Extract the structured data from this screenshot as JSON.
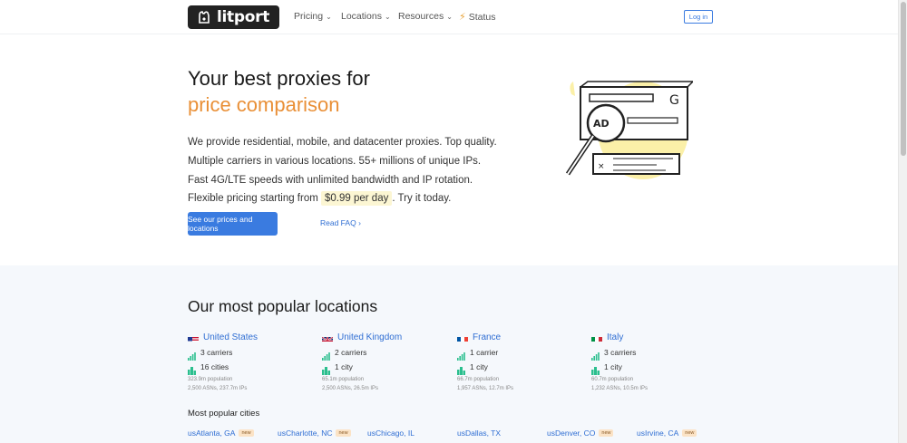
{
  "nav": {
    "logo_text": "litport",
    "items": [
      {
        "label": "Pricing"
      },
      {
        "label": "Locations"
      },
      {
        "label": "Resources"
      }
    ],
    "status_label": "Status",
    "login_label": "Log in"
  },
  "hero": {
    "title_line1": "Your best proxies for",
    "title_line2": "price comparison",
    "lines": [
      "We provide residential, mobile, and datacenter proxies. Top quality.",
      "Multiple carriers in various locations. 55+ millions of unique IPs.",
      "Fast 4G/LTE speeds with unlimited bandwidth and IP rotation."
    ],
    "pricing_prefix": "Flexible pricing starting from",
    "price": "$0.99 per day",
    "pricing_suffix": ". Try it today.",
    "cta_label": "See our prices and locations",
    "faq_label": "Read FAQ",
    "faq_arrow": "›"
  },
  "locations": {
    "heading": "Our most popular locations",
    "countries": [
      {
        "name": "United States",
        "carriers": "3 carriers",
        "cities": "16 cities",
        "population": "323.9m population",
        "asns": "2,500 ASNs, 237.7m IPs"
      },
      {
        "name": "United Kingdom",
        "carriers": "2 carriers",
        "cities": "1 city",
        "population": "65.1m population",
        "asns": "2,500 ASNs, 26.5m IPs"
      },
      {
        "name": "France",
        "carriers": "1 carrier",
        "cities": "1 city",
        "population": "66.7m population",
        "asns": "1,957 ASNs, 12.7m IPs"
      },
      {
        "name": "Italy",
        "carriers": "3 carriers",
        "cities": "1 city",
        "population": "60.7m population",
        "asns": "1,232 ASNs, 10.5m IPs"
      }
    ],
    "cities_heading": "Most popular cities",
    "cities": [
      {
        "label": "usAtlanta, GA",
        "badge": "new"
      },
      {
        "label": "usCharlotte, NC",
        "badge": "new"
      },
      {
        "label": "usChicago, IL",
        "badge": ""
      },
      {
        "label": "usDallas, TX",
        "badge": ""
      },
      {
        "label": "usDenver, CO",
        "badge": "new"
      },
      {
        "label": "usIrvine, CA",
        "badge": "new"
      }
    ]
  },
  "colors": {
    "accent_orange": "#e98f36",
    "link_blue": "#2f6ed3",
    "cta_blue": "#3a7be0",
    "stat_green": "#2bbf8e",
    "section_bg": "#f5f8fc"
  }
}
